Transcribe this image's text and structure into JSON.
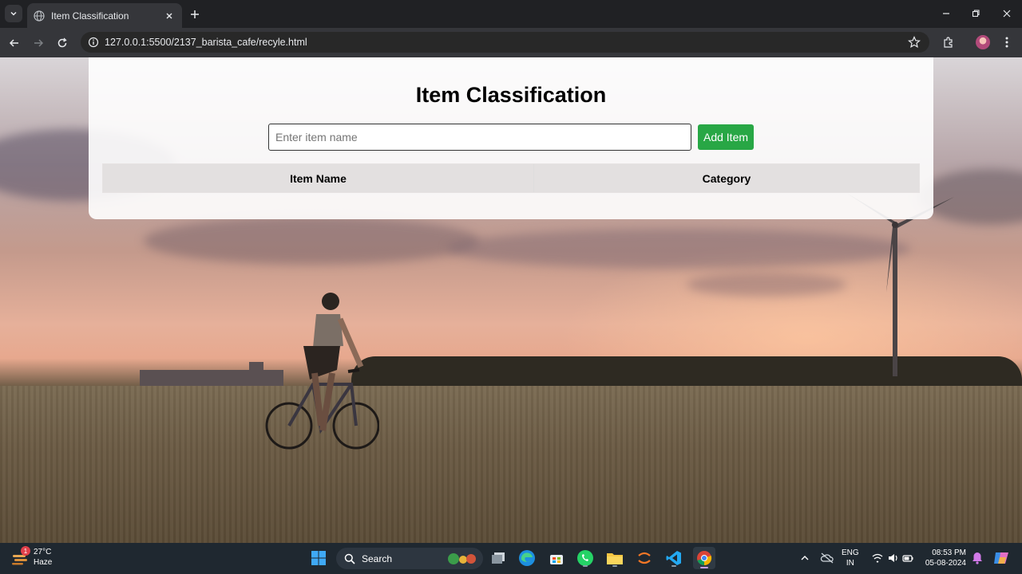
{
  "browser": {
    "tab_title": "Item Classification",
    "url": "127.0.0.1:5500/2137_barista_cafe/recyle.html"
  },
  "page": {
    "title": "Item Classification",
    "input_placeholder": "Enter item name",
    "input_value": "",
    "add_button_label": "Add Item",
    "table_headers": [
      "Item Name",
      "Category"
    ],
    "table_rows": []
  },
  "taskbar": {
    "weather_temp": "27°C",
    "weather_desc": "Haze",
    "weather_badge": "1",
    "search_label": "Search",
    "language": "ENG",
    "region": "IN",
    "time": "08:53 PM",
    "date": "05-08-2024"
  },
  "colors": {
    "add_button": "#28a745",
    "taskbar_bg": "#1f2830",
    "chrome_bg": "#202124"
  },
  "icons": [
    "search-icon",
    "globe-icon",
    "close-icon",
    "plus-icon",
    "minimize-icon",
    "maximize-icon",
    "back-icon",
    "forward-icon",
    "reload-icon",
    "info-icon",
    "star-icon",
    "extensions-icon",
    "more-icon",
    "windows-icon",
    "edge-icon",
    "whatsapp-icon",
    "chrome-icon",
    "vscode-icon"
  ]
}
